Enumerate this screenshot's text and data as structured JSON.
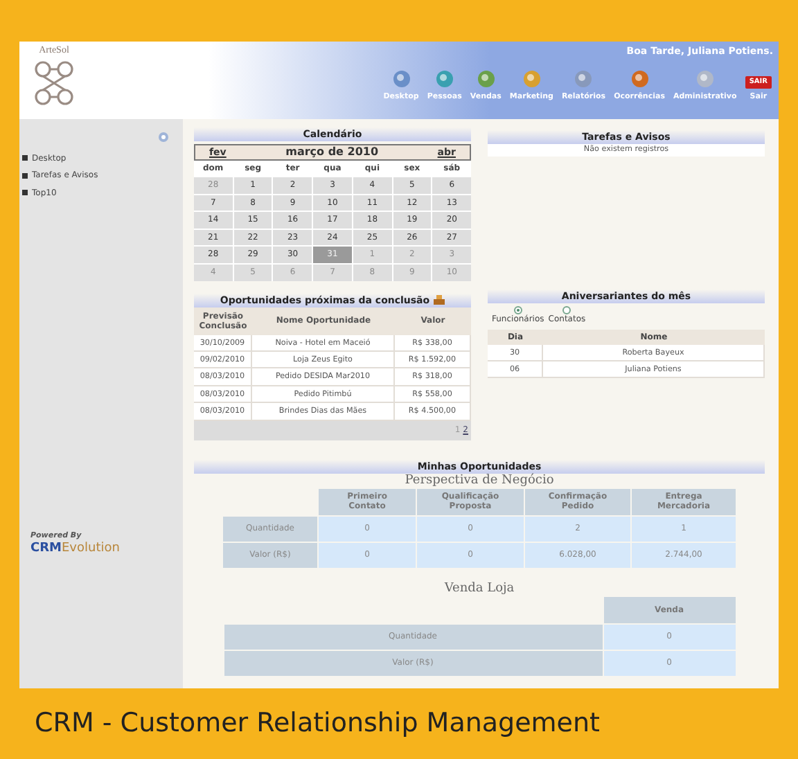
{
  "header": {
    "logo": "ArteSol",
    "greeting": "Boa Tarde, Juliana Potiens.",
    "nav": [
      {
        "label": "Desktop"
      },
      {
        "label": "Pessoas"
      },
      {
        "label": "Vendas"
      },
      {
        "label": "Marketing"
      },
      {
        "label": "Relatórios"
      },
      {
        "label": "Ocorrências"
      },
      {
        "label": "Administrativo"
      },
      {
        "label": "Sair",
        "badge": "SAIR"
      }
    ]
  },
  "sidebar": {
    "items": [
      "Desktop",
      "Tarefas e Avisos",
      "Top10"
    ],
    "powered_by": "Powered By",
    "brand": [
      "CRM",
      "Evolution"
    ]
  },
  "calendar": {
    "title": "Calendário",
    "prev": "fev",
    "month": "março de 2010",
    "next": "abr",
    "weekdays": [
      "dom",
      "seg",
      "ter",
      "qua",
      "qui",
      "sex",
      "sáb"
    ],
    "weeks": [
      [
        {
          "day": "28",
          "other_month": true,
          "selected": false
        },
        {
          "day": "1",
          "other_month": false,
          "selected": false
        },
        {
          "day": "2",
          "other_month": false,
          "selected": false
        },
        {
          "day": "3",
          "other_month": false,
          "selected": false
        },
        {
          "day": "4",
          "other_month": false,
          "selected": false
        },
        {
          "day": "5",
          "other_month": false,
          "selected": false
        },
        {
          "day": "6",
          "other_month": false,
          "selected": false
        }
      ],
      [
        {
          "day": "7",
          "other_month": false,
          "selected": false
        },
        {
          "day": "8",
          "other_month": false,
          "selected": false
        },
        {
          "day": "9",
          "other_month": false,
          "selected": false
        },
        {
          "day": "10",
          "other_month": false,
          "selected": false
        },
        {
          "day": "11",
          "other_month": false,
          "selected": false
        },
        {
          "day": "12",
          "other_month": false,
          "selected": false
        },
        {
          "day": "13",
          "other_month": false,
          "selected": false
        }
      ],
      [
        {
          "day": "14",
          "other_month": false,
          "selected": false
        },
        {
          "day": "15",
          "other_month": false,
          "selected": false
        },
        {
          "day": "16",
          "other_month": false,
          "selected": false
        },
        {
          "day": "17",
          "other_month": false,
          "selected": false
        },
        {
          "day": "18",
          "other_month": false,
          "selected": false
        },
        {
          "day": "19",
          "other_month": false,
          "selected": false
        },
        {
          "day": "20",
          "other_month": false,
          "selected": false
        }
      ],
      [
        {
          "day": "21",
          "other_month": false,
          "selected": false
        },
        {
          "day": "22",
          "other_month": false,
          "selected": false
        },
        {
          "day": "23",
          "other_month": false,
          "selected": false
        },
        {
          "day": "24",
          "other_month": false,
          "selected": false
        },
        {
          "day": "25",
          "other_month": false,
          "selected": false
        },
        {
          "day": "26",
          "other_month": false,
          "selected": false
        },
        {
          "day": "27",
          "other_month": false,
          "selected": false
        }
      ],
      [
        {
          "day": "28",
          "other_month": false,
          "selected": false
        },
        {
          "day": "29",
          "other_month": false,
          "selected": false
        },
        {
          "day": "30",
          "other_month": false,
          "selected": false
        },
        {
          "day": "31",
          "other_month": false,
          "selected": true
        },
        {
          "day": "1",
          "other_month": true,
          "selected": false
        },
        {
          "day": "2",
          "other_month": true,
          "selected": false
        },
        {
          "day": "3",
          "other_month": true,
          "selected": false
        }
      ],
      [
        {
          "day": "4",
          "other_month": true,
          "selected": false
        },
        {
          "day": "5",
          "other_month": true,
          "selected": false
        },
        {
          "day": "6",
          "other_month": true,
          "selected": false
        },
        {
          "day": "7",
          "other_month": true,
          "selected": false
        },
        {
          "day": "8",
          "other_month": true,
          "selected": false
        },
        {
          "day": "9",
          "other_month": true,
          "selected": false
        },
        {
          "day": "10",
          "other_month": true,
          "selected": false
        }
      ]
    ]
  },
  "opportunities": {
    "title": "Oportunidades próximas da conclusão",
    "columns": [
      "Previsão Conclusão",
      "Nome Oportunidade",
      "Valor"
    ],
    "rows": [
      [
        "30/10/2009",
        "Noiva - Hotel em Maceió",
        "R$ 338,00"
      ],
      [
        "09/02/2010",
        "Loja Zeus Egito",
        "R$ 1.592,00"
      ],
      [
        "08/03/2010",
        "Pedido DESIDA Mar2010",
        "R$ 318,00"
      ],
      [
        "08/03/2010",
        "Pedido Pitimbú",
        "R$ 558,00"
      ],
      [
        "08/03/2010",
        "Brindes Dias das Mães",
        "R$ 4.500,00"
      ]
    ],
    "pages": [
      {
        "label": "1",
        "selected": true
      },
      {
        "label": "2",
        "selected": false
      }
    ]
  },
  "tasks": {
    "title": "Tarefas e Avisos",
    "message": "Não existem registros"
  },
  "birthdays": {
    "title": "Aniversariantes do mês",
    "options": [
      {
        "label": "Funcionários",
        "selected": true
      },
      {
        "label": "Contatos",
        "selected": false
      }
    ],
    "columns": [
      "Dia",
      "Nome"
    ],
    "rows": [
      [
        "30",
        "Roberta Bayeux"
      ],
      [
        "06",
        "Juliana Potiens"
      ]
    ]
  },
  "my_opportunities": {
    "title": "Minhas Oportunidades",
    "pipeline": {
      "title": "Perspectiva de Negócio",
      "columns": [
        "Primeiro Contato",
        "Qualificação Proposta",
        "Confirmação Pedido",
        "Entrega Mercadoria"
      ],
      "rows": [
        {
          "label": "Quantidade",
          "values": [
            "0",
            "0",
            "2",
            "1"
          ]
        },
        {
          "label": "Valor (R$)",
          "values": [
            "0",
            "0",
            "6.028,00",
            "2.744,00"
          ]
        }
      ]
    },
    "store": {
      "title": "Venda Loja",
      "columns": [
        "Venda"
      ],
      "rows": [
        {
          "label": "Quantidade",
          "values": [
            "0"
          ]
        },
        {
          "label": "Valor (R$)",
          "values": [
            "0"
          ]
        }
      ]
    }
  },
  "caption": "CRM - Customer Relationship Management"
}
